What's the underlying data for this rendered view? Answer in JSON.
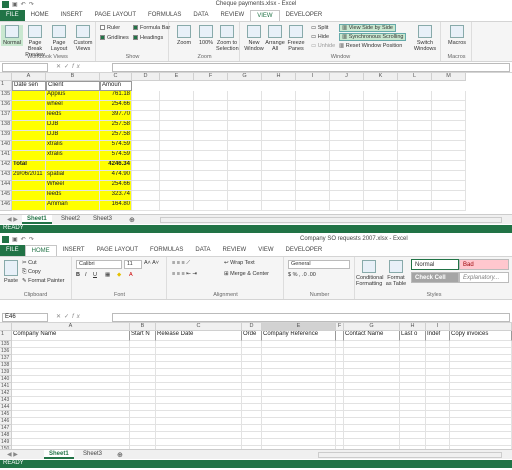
{
  "w1": {
    "title": "Cheque payments.xlsx - Excel",
    "tabs": [
      "FILE",
      "HOME",
      "INSERT",
      "PAGE LAYOUT",
      "FORMULAS",
      "DATA",
      "REVIEW",
      "VIEW",
      "DEVELOPER"
    ],
    "views": {
      "normal": "Normal",
      "pagebreak": "Page Break Preview",
      "pagelayout": "Page Layout",
      "custom": "Custom Views",
      "label": "Workbook Views"
    },
    "show": {
      "ruler": "Ruler",
      "formulabar": "Formula Bar",
      "gridlines": "Gridlines",
      "headings": "Headings",
      "label": "Show"
    },
    "zoom": {
      "zoom": "Zoom",
      "hundred": "100%",
      "selection": "Zoom to Selection",
      "label": "Zoom"
    },
    "window": {
      "newwin": "New Window",
      "arrange": "Arrange All",
      "freeze": "Freeze Panes",
      "split": "Split",
      "hide": "Hide",
      "unhide": "Unhide",
      "sbs": "View Side by Side",
      "sync": "Synchronous Scrolling",
      "reset": "Reset Window Position",
      "switch": "Switch Windows",
      "label": "Window"
    },
    "macros": {
      "macros": "Macros",
      "label": "Macros"
    },
    "columns": [
      "A",
      "B",
      "C",
      "D",
      "E",
      "F",
      "G",
      "H",
      "I",
      "J",
      "K",
      "L",
      "M"
    ],
    "header": {
      "rownum": "1",
      "a": "Date sen",
      "b": "Client",
      "c": "Amoun"
    },
    "rows": [
      {
        "n": "135",
        "a": "",
        "b": "Appius",
        "c": "761.18"
      },
      {
        "n": "136",
        "a": "",
        "b": "wheel",
        "c": "254.66"
      },
      {
        "n": "137",
        "a": "",
        "b": "leeds",
        "c": "397.70"
      },
      {
        "n": "138",
        "a": "",
        "b": "DJB",
        "c": "257.58"
      },
      {
        "n": "139",
        "a": "",
        "b": "DJB",
        "c": "257.58"
      },
      {
        "n": "140",
        "a": "",
        "b": "xtralis",
        "c": "574.59"
      },
      {
        "n": "141",
        "a": "",
        "b": "xtralis",
        "c": "574.59"
      },
      {
        "n": "142",
        "a": "Total",
        "b": "",
        "c": "4246.34"
      },
      {
        "n": "143",
        "a": "29/06/2011",
        "b": "spatial",
        "c": "474.90"
      },
      {
        "n": "144",
        "a": "",
        "b": "Wheel",
        "c": "254.66"
      },
      {
        "n": "145",
        "a": "",
        "b": "leeds",
        "c": "323.74"
      },
      {
        "n": "146",
        "a": "",
        "b": "Amman",
        "c": "164.80"
      }
    ],
    "sheets": [
      "Sheet1",
      "Sheet2",
      "Sheet3"
    ],
    "status": "READY"
  },
  "w2": {
    "title": "Company SO requests 2007.xlsx - Excel",
    "tabs": [
      "FILE",
      "HOME",
      "INSERT",
      "PAGE LAYOUT",
      "FORMULAS",
      "DATA",
      "REVIEW",
      "VIEW",
      "DEVELOPER"
    ],
    "clipboard": {
      "cut": "Cut",
      "copy": "Copy",
      "painter": "Format Painter",
      "paste": "Paste",
      "label": "Clipboard"
    },
    "font": {
      "name": "Calibri",
      "size": "11",
      "label": "Font"
    },
    "align": {
      "wrap": "Wrap Text",
      "merge": "Merge & Center",
      "label": "Alignment"
    },
    "number": {
      "format": "General",
      "label": "Number"
    },
    "styles": {
      "cond": "Conditional Formatting",
      "table": "Format as Table",
      "normal": "Normal",
      "bad": "Bad",
      "check": "Check Cell",
      "explanatory": "Explanatory...",
      "label": "Styles"
    },
    "namebox": "E46",
    "columns": [
      "A",
      "B",
      "C",
      "D",
      "E",
      "F",
      "G",
      "H",
      "I"
    ],
    "headers": [
      "Company Name",
      "Start N",
      "Release Date",
      "Orde",
      "Company Reference",
      "",
      "Contact Name",
      "Last o",
      "Indef",
      "Copy invoices"
    ],
    "rows": [
      "135",
      "136",
      "137",
      "138",
      "139",
      "140",
      "141",
      "142",
      "143",
      "144",
      "145",
      "146",
      "147",
      "148",
      "149",
      "150"
    ],
    "sheets": [
      "Sheet1",
      "Sheet3"
    ],
    "status": "READY"
  },
  "colors": {
    "excel_green": "#217346",
    "highlight": "#ffff00"
  }
}
